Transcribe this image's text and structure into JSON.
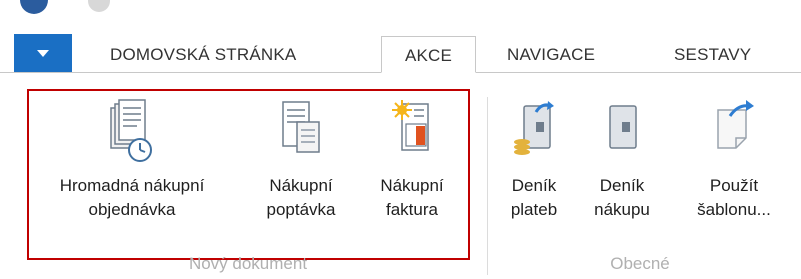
{
  "tabs": [
    {
      "label": "DOMOVSKÁ STRÁNKA"
    },
    {
      "label": "AKCE"
    },
    {
      "label": "NAVIGACE"
    },
    {
      "label": "SESTAVY"
    }
  ],
  "ribbon": {
    "new_document": {
      "group_label": "Nový dokument",
      "buttons": [
        {
          "line1": "Hromadná nákupní",
          "line2": "objednávka",
          "icon": "batch-order-clock-icon"
        },
        {
          "line1": "Nákupní",
          "line2": "poptávka",
          "icon": "purchase-quote-icon"
        },
        {
          "line1": "Nákupní",
          "line2": "faktura",
          "icon": "purchase-invoice-icon"
        }
      ]
    },
    "general": {
      "group_label": "Obecné",
      "buttons": [
        {
          "line1": "Deník",
          "line2": "plateb",
          "icon": "payment-journal-icon"
        },
        {
          "line1": "Deník",
          "line2": "nákupu",
          "icon": "purchase-journal-icon"
        },
        {
          "line1": "Použít",
          "line2": "šablonu...",
          "icon": "use-template-icon"
        }
      ]
    }
  },
  "colors": {
    "accent": "#1a6fc4",
    "selection": "#c00000"
  }
}
